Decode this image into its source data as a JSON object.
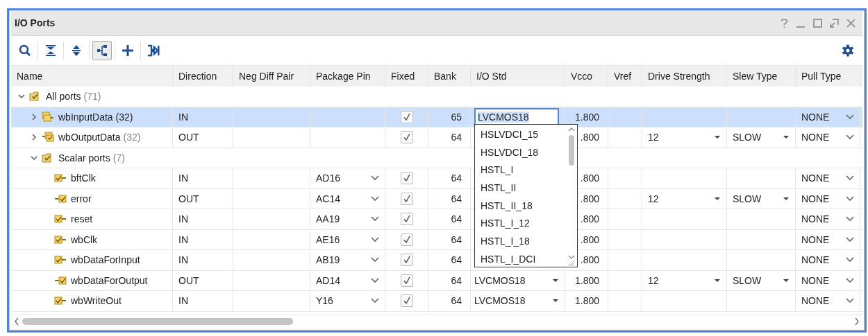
{
  "window": {
    "title": "I/O Ports"
  },
  "toolbar": [
    {
      "kind": "search",
      "selected": false
    },
    {
      "kind": "collapse",
      "selected": false
    },
    {
      "kind": "expand",
      "selected": false
    },
    {
      "kind": "group",
      "selected": true
    },
    {
      "kind": "add",
      "selected": false
    },
    {
      "kind": "assign",
      "selected": false
    }
  ],
  "columns": [
    "Name",
    "Direction",
    "Neg Diff Pair",
    "Package Pin",
    "Fixed",
    "Bank",
    "I/O Std",
    "Vcco",
    "Vref",
    "Drive Strength",
    "Slew Type",
    "Pull Type"
  ],
  "ports": [
    {
      "kind": "group",
      "name": "All ports",
      "count": "(71)",
      "expanded": true,
      "selected": false,
      "children": [
        {
          "kind": "input_bus",
          "name": "wbInputData",
          "count": "(32)",
          "expanded": false,
          "selected": true,
          "direction": "IN",
          "fixed": true,
          "bank": "65",
          "io_std": "LVCMOS18",
          "editing": true,
          "vcco": "1.800",
          "pull_type": "NONE"
        },
        {
          "kind": "output_bus",
          "name": "wbOutputData",
          "count": "(32)",
          "expanded": false,
          "selected": false,
          "direction": "OUT",
          "fixed": true,
          "bank": "64",
          "vcco": ".800",
          "drive_strength": "12",
          "slew_type": "SLOW",
          "pull_type": "NONE"
        },
        {
          "kind": "group",
          "name": "Scalar ports",
          "count": "(7)",
          "expanded": true,
          "selected": false,
          "children": [
            {
              "kind": "input",
              "name": "bftClk",
              "selected": false,
              "direction": "IN",
              "package_pin": "AD16",
              "fixed": true,
              "bank": "64",
              "vcco": ".800",
              "pull_type": "NONE"
            },
            {
              "kind": "output",
              "name": "error",
              "selected": false,
              "direction": "OUT",
              "package_pin": "AC14",
              "fixed": true,
              "bank": "64",
              "vcco": ".800",
              "drive_strength": "12",
              "slew_type": "SLOW",
              "pull_type": "NONE"
            },
            {
              "kind": "input",
              "name": "reset",
              "selected": false,
              "direction": "IN",
              "package_pin": "AA19",
              "fixed": true,
              "bank": "64",
              "vcco": ".800",
              "pull_type": "NONE"
            },
            {
              "kind": "input",
              "name": "wbClk",
              "selected": false,
              "direction": "IN",
              "package_pin": "AE16",
              "fixed": true,
              "bank": "64",
              "vcco": ".800",
              "pull_type": "NONE"
            },
            {
              "kind": "input",
              "name": "wbDataForInput",
              "selected": false,
              "direction": "IN",
              "package_pin": "AB19",
              "fixed": true,
              "bank": "64",
              "vcco": ".800",
              "pull_type": "NONE"
            },
            {
              "kind": "output",
              "name": "wbDataForOutput",
              "selected": false,
              "direction": "OUT",
              "package_pin": "AD14",
              "fixed": true,
              "bank": "64",
              "io_std": "LVCMOS18",
              "editing": false,
              "vcco": "1.800",
              "drive_strength": "12",
              "slew_type": "SLOW",
              "pull_type": "NONE"
            },
            {
              "kind": "input",
              "name": "wbWriteOut",
              "selected": false,
              "direction": "IN",
              "package_pin": "Y16",
              "fixed": true,
              "bank": "64",
              "io_std": "LVCMOS18",
              "editing": false,
              "vcco": "1.800",
              "pull_type": "NONE"
            }
          ]
        }
      ]
    }
  ],
  "popup": {
    "options": [
      "HSLVDCI_15",
      "HSLVDCI_18",
      "HSTL_I",
      "HSTL_II",
      "HSTL_II_18",
      "HSTL_I_12",
      "HSTL_I_18",
      "HSTL_I_DCI"
    ]
  }
}
